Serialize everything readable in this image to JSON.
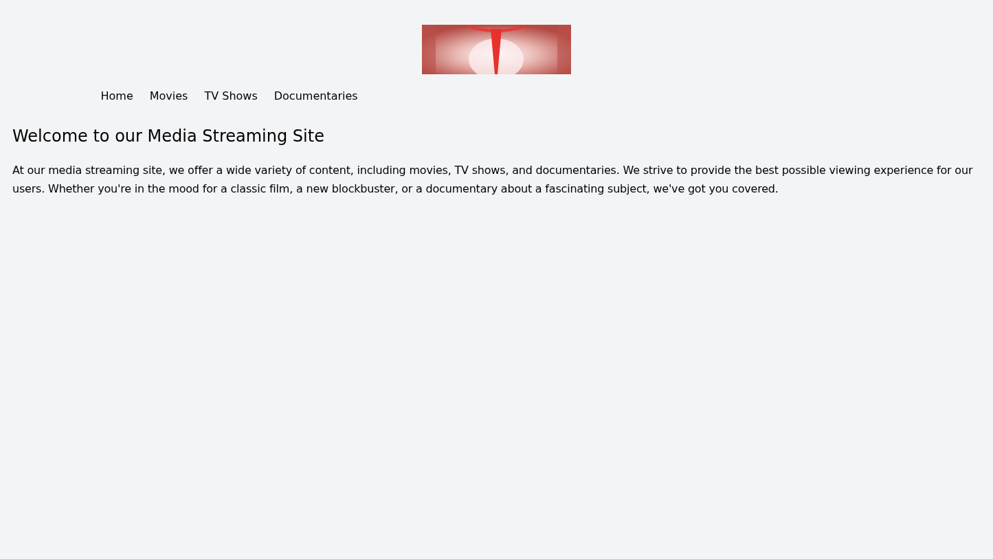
{
  "nav": {
    "items": [
      {
        "label": "Home"
      },
      {
        "label": "Movies"
      },
      {
        "label": "TV Shows"
      },
      {
        "label": "Documentaries"
      }
    ]
  },
  "main": {
    "heading": "Welcome to our Media Streaming Site",
    "paragraph": "At our media streaming site, we offer a wide variety of content, including movies, TV shows, and documentaries. We strive to provide the best possible viewing experience for our users. Whether you're in the mood for a classic film, a new blockbuster, or a documentary about a fascinating subject, we've got you covered."
  }
}
